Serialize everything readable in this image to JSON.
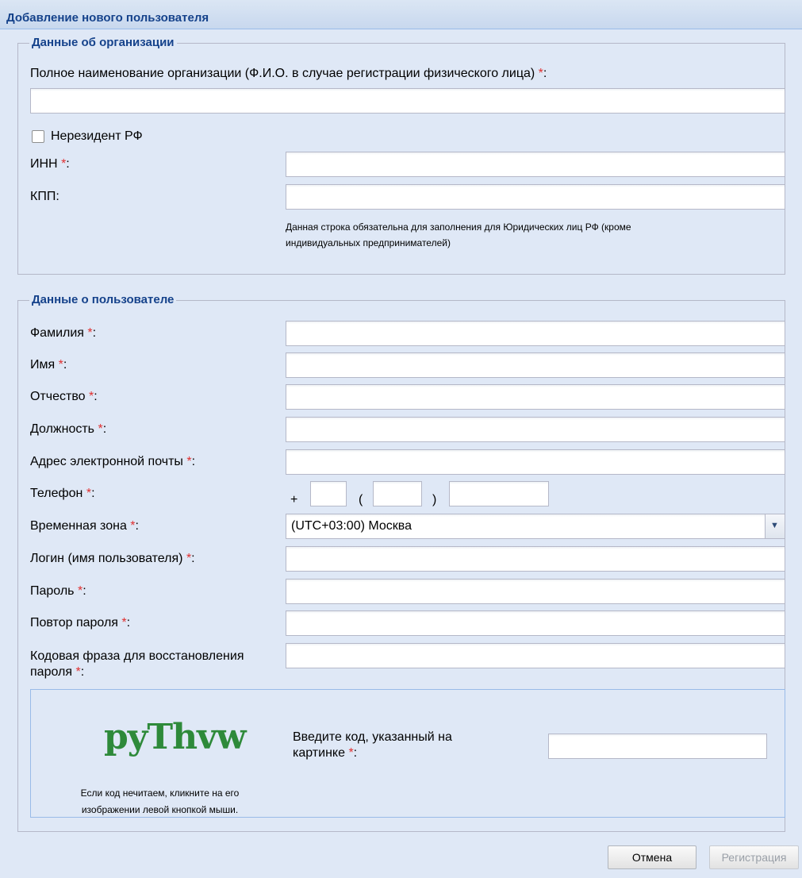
{
  "window": {
    "title": "Добавление нового пользователя"
  },
  "org": {
    "legend": "Данные об организации",
    "full_name_label": "Полное наименование организации (Ф.И.О. в случае регистрации физического лица)",
    "full_name_value": "",
    "nonresident_label": "Нерезидент РФ",
    "nonresident_checked": false,
    "inn_label": "ИНН",
    "inn_value": "",
    "kpp_label": "КПП:",
    "kpp_value": "",
    "kpp_note_line1": "Данная строка обязательна для заполнения для Юридических лиц РФ (кроме",
    "kpp_note_line2": "индивидуальных предпринимателей)"
  },
  "user": {
    "legend": "Данные о пользователе",
    "lastname_label": "Фамилия",
    "firstname_label": "Имя",
    "patronymic_label": "Отчество",
    "position_label": "Должность",
    "email_label": "Адрес электронной почты",
    "phone_label": "Телефон",
    "phone_plus": "+",
    "phone_open_paren": "(",
    "phone_close_paren": ")",
    "timezone_label": "Временная зона",
    "timezone_value": "(UTC+03:00) Москва",
    "login_label": "Логин (имя пользователя)",
    "password_label": "Пароль",
    "password_repeat_label": "Повтор пароля",
    "codephrase_label_line1": "Кодовая фраза для восстановления",
    "codephrase_label_line2": "пароля"
  },
  "captcha": {
    "image_text": "pyThvw",
    "hint_line1": "Если код нечитаем, кликните на его",
    "hint_line2": "изображении левой кнопкой мыши.",
    "prompt_line1": "Введите код, указанный на",
    "prompt_line2": "картинке",
    "value": ""
  },
  "required_mark": "*",
  "colon": ":",
  "buttons": {
    "cancel": "Отмена",
    "register": "Регистрация"
  },
  "icons": {
    "combo_arrow": "chevron-down-icon"
  }
}
